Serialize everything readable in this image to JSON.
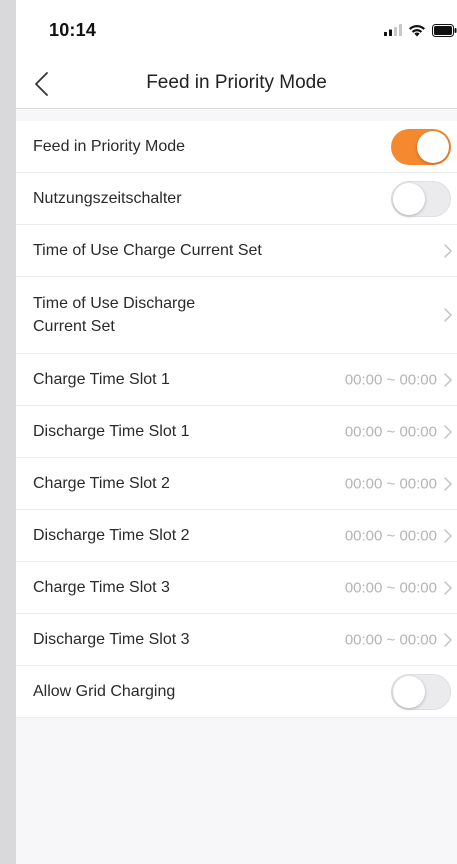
{
  "status_bar": {
    "time": "10:14",
    "icons": [
      "signal-icon",
      "wifi-icon",
      "battery-icon"
    ]
  },
  "nav": {
    "title": "Feed in Priority Mode",
    "back_icon": "chevron-left-icon"
  },
  "colors": {
    "accent": "#f5892f",
    "toggle_off": "#ebebed",
    "value_text": "#b4b4b4"
  },
  "rows": [
    {
      "label": "Feed in Priority Mode",
      "type": "toggle",
      "on": true
    },
    {
      "label": "Nutzungszeitschalter",
      "type": "toggle",
      "on": false
    },
    {
      "label": "Time of Use Charge Current Set",
      "type": "link"
    },
    {
      "label": "Time of Use Discharge Current Set",
      "type": "link"
    },
    {
      "label": "Charge Time Slot 1",
      "type": "value",
      "value": "00:00 ~ 00:00"
    },
    {
      "label": "Discharge Time Slot 1",
      "type": "value",
      "value": "00:00 ~ 00:00"
    },
    {
      "label": "Charge Time Slot 2",
      "type": "value",
      "value": "00:00 ~ 00:00"
    },
    {
      "label": "Discharge Time Slot 2",
      "type": "value",
      "value": "00:00 ~ 00:00"
    },
    {
      "label": "Charge Time Slot 3",
      "type": "value",
      "value": "00:00 ~ 00:00"
    },
    {
      "label": "Discharge Time Slot 3",
      "type": "value",
      "value": "00:00 ~ 00:00"
    },
    {
      "label": "Allow Grid Charging",
      "type": "toggle",
      "on": false
    }
  ]
}
